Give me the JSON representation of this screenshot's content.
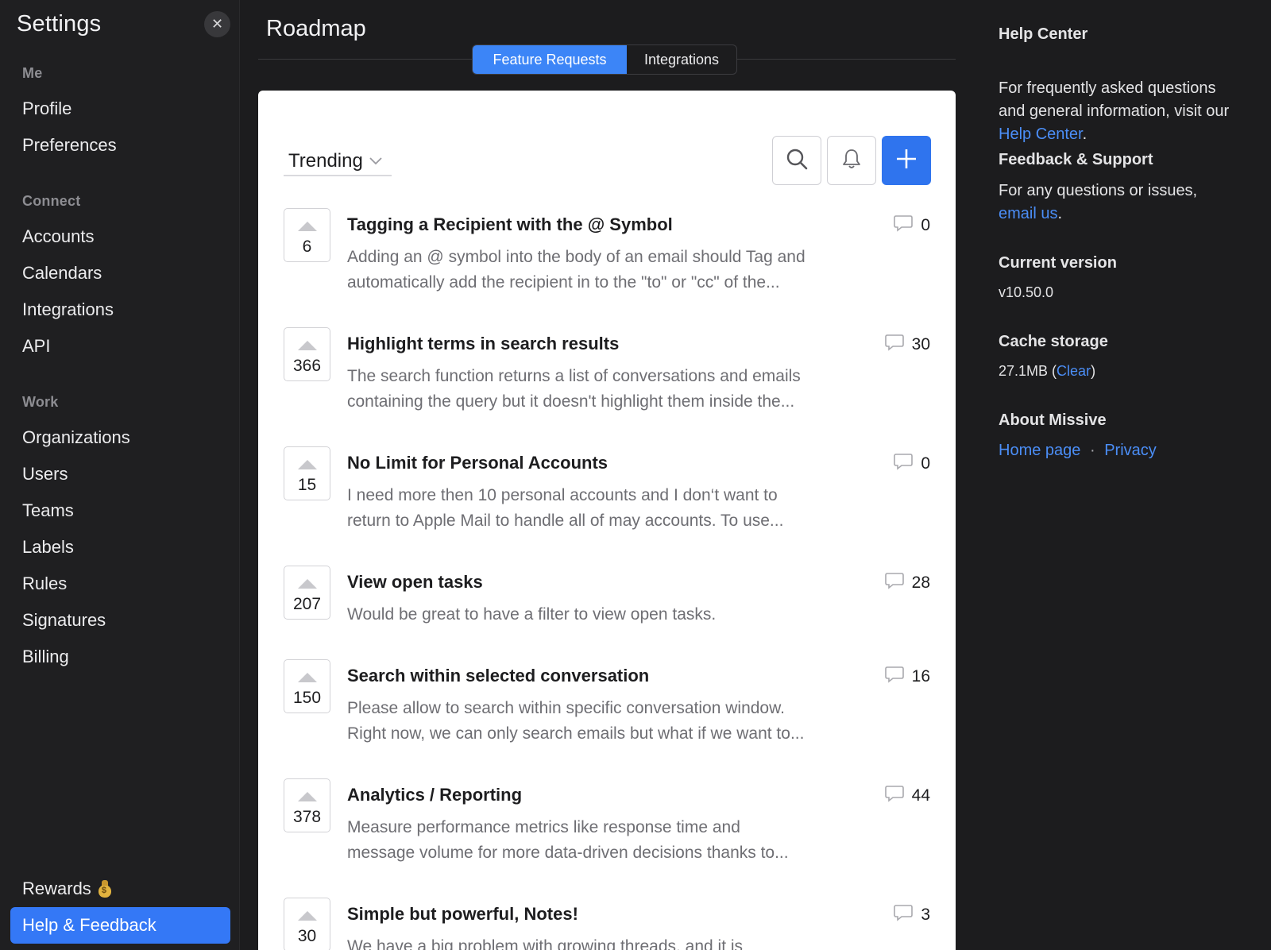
{
  "sidebar": {
    "title": "Settings",
    "close_label": "✕",
    "sections": {
      "me": "Me",
      "connect": "Connect",
      "work": "Work"
    },
    "items": {
      "profile": "Profile",
      "preferences": "Preferences",
      "accounts": "Accounts",
      "calendars": "Calendars",
      "integrations": "Integrations",
      "api": "API",
      "organizations": "Organizations",
      "users": "Users",
      "teams": "Teams",
      "labels": "Labels",
      "rules": "Rules",
      "signatures": "Signatures",
      "billing": "Billing"
    },
    "rewards": "Rewards",
    "help_feedback": "Help & Feedback"
  },
  "main": {
    "title": "Roadmap",
    "tabs": [
      "Feature Requests",
      "Integrations"
    ],
    "sort_label": "Trending",
    "posts": [
      {
        "votes": "6",
        "title": "Tagging a Recipient with the @ Symbol",
        "desc": "Adding an @ symbol into the body of an email should Tag and\nautomatically add the recipient in to the \"to\" or \"cc\" of the...",
        "comments": "0"
      },
      {
        "votes": "366",
        "title": "Highlight terms in search results",
        "desc": "The search function returns a list of conversations and emails\ncontaining the query but it doesn't highlight them inside the...",
        "comments": "30"
      },
      {
        "votes": "15",
        "title": "No Limit for Personal Accounts",
        "desc": "I need more then 10 personal accounts and I don‘t want to\nreturn to Apple Mail to handle all of may accounts. To use...",
        "comments": "0"
      },
      {
        "votes": "207",
        "title": "View open tasks",
        "desc": "Would be great to have a filter to view open tasks.",
        "comments": "28"
      },
      {
        "votes": "150",
        "title": "Search within selected conversation",
        "desc": "Please allow to search within specific conversation window.\nRight now, we can only search emails but what if we want to...",
        "comments": "16"
      },
      {
        "votes": "378",
        "title": "Analytics / Reporting",
        "desc": "Measure performance metrics like response time and\nmessage volume for more data-driven decisions thanks to...",
        "comments": "44"
      },
      {
        "votes": "30",
        "title": "Simple but powerful, Notes!",
        "desc": "We have a big problem with growing threads, and it is",
        "comments": "3"
      }
    ]
  },
  "right": {
    "help_center": {
      "heading": "Help Center",
      "text_before": "For frequently asked questions\nand general information, visit our",
      "link": "Help Center",
      "text_after": "."
    },
    "feedback": {
      "heading": "Feedback & Support",
      "text_before": "For any questions or issues,",
      "link": "email us",
      "text_after": "."
    },
    "version": {
      "heading": "Current version",
      "value": "v10.50.0"
    },
    "cache": {
      "heading": "Cache storage",
      "value": "27.1MB",
      "open_paren": " (",
      "link": "Clear",
      "close_paren": ")"
    },
    "about": {
      "heading": "About Missive",
      "home_link": "Home page",
      "separator": "·",
      "privacy_link": "Privacy"
    }
  },
  "colors": {
    "accent": "#3478f6",
    "link": "#4b8ef7",
    "sidebar_bg": "#1f1f21",
    "panel_bg": "#ffffff"
  },
  "icons": {
    "search": "search-icon",
    "bell": "bell-icon",
    "plus": "plus-icon",
    "comment": "comment-icon",
    "chevron": "chevron-down-icon",
    "close": "close-icon",
    "bag": "money-bag-icon"
  }
}
